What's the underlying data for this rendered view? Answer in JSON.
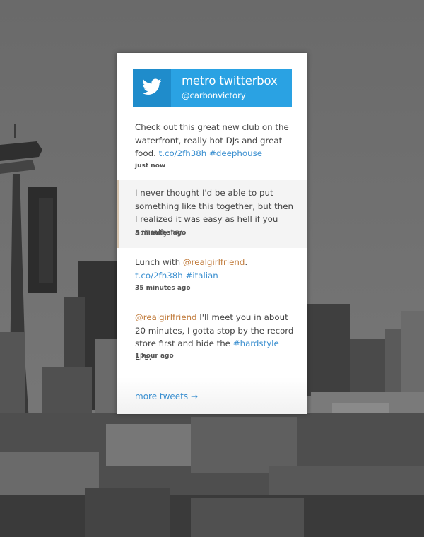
{
  "widget": {
    "title": "metro twitterbox",
    "handle": "@carbonvictory"
  },
  "tweets": [
    {
      "segments": [
        {
          "text": "Check out this great new club on the waterfront, really hot DJs and great food. ",
          "type": "plain"
        },
        {
          "text": "t.co/2fh38h",
          "type": "link"
        },
        {
          "text": " ",
          "type": "plain"
        },
        {
          "text": "#deephouse",
          "type": "hashtag"
        }
      ],
      "time": "just now",
      "highlighted": false
    },
    {
      "segments": [
        {
          "text": "I never thought I'd be able to put something like this together, but then I realized it was easy as hell if you actually try.",
          "type": "plain"
        }
      ],
      "time": "5 minutes ago",
      "highlighted": true
    },
    {
      "segments": [
        {
          "text": "Lunch with ",
          "type": "plain"
        },
        {
          "text": "@realgirlfriend",
          "type": "mention"
        },
        {
          "text": ". ",
          "type": "plain"
        },
        {
          "text": "t.co/2fh38h",
          "type": "link"
        },
        {
          "text": " ",
          "type": "plain"
        },
        {
          "text": "#italian",
          "type": "hashtag"
        }
      ],
      "time": "35 minutes ago",
      "highlighted": false
    },
    {
      "segments": [
        {
          "text": "@realgirlfriend",
          "type": "mention"
        },
        {
          "text": " I'll meet you in about 20 minutes, I gotta stop by the record store first and hide the ",
          "type": "plain"
        },
        {
          "text": "#hardstyle",
          "type": "hashtag"
        },
        {
          "text": " LPs.",
          "type": "plain"
        }
      ],
      "time": "1 hour ago",
      "highlighted": false
    }
  ],
  "footer": {
    "more_label": "more tweets →"
  },
  "colors": {
    "header_bg": "#2aa2e3",
    "icon_bg": "#1f8ccb",
    "link": "#3a8fd0",
    "mention": "#c07a3a"
  },
  "icons": {
    "header_icon": "twitter-bird-icon"
  }
}
